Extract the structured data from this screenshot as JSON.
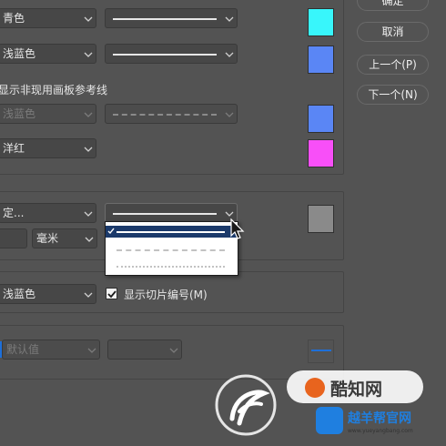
{
  "colors": {
    "cyan": "#38f6fb",
    "light_blue": "#5a86f5",
    "magenta": "#f84ff8",
    "gray": "#8a8a8a",
    "menu_selection": "#1b3a6b",
    "background": "#535353"
  },
  "buttons": {
    "ok": "确定",
    "cancel": "取消",
    "prev": "上一个(P)",
    "next": "下一个(N)"
  },
  "rows": {
    "row1_color": "青色",
    "row2_color": "浅蓝色",
    "inactive_label": "显示非现用画板参考线",
    "row3_color": "浅蓝色",
    "row4_color": "洋红"
  },
  "grid": {
    "color_value": "定...",
    "unit": "毫米"
  },
  "line_style_menu": {
    "options": [
      "solid",
      "dashed",
      "dotted"
    ],
    "selected": "solid"
  },
  "slices": {
    "color": "浅蓝色",
    "checkbox_label": "显示切片编号(M)",
    "checkbox_checked": true
  },
  "bottom": {
    "default_value": "默认值"
  },
  "icons": {
    "dropdown": "chevron-down-icon",
    "cursor": "mouse-pointer-icon",
    "check": "check-icon"
  },
  "watermark": {
    "brand": "酷知网",
    "site": "越羊帮官网",
    "url": "www.yueyangbang.com"
  }
}
